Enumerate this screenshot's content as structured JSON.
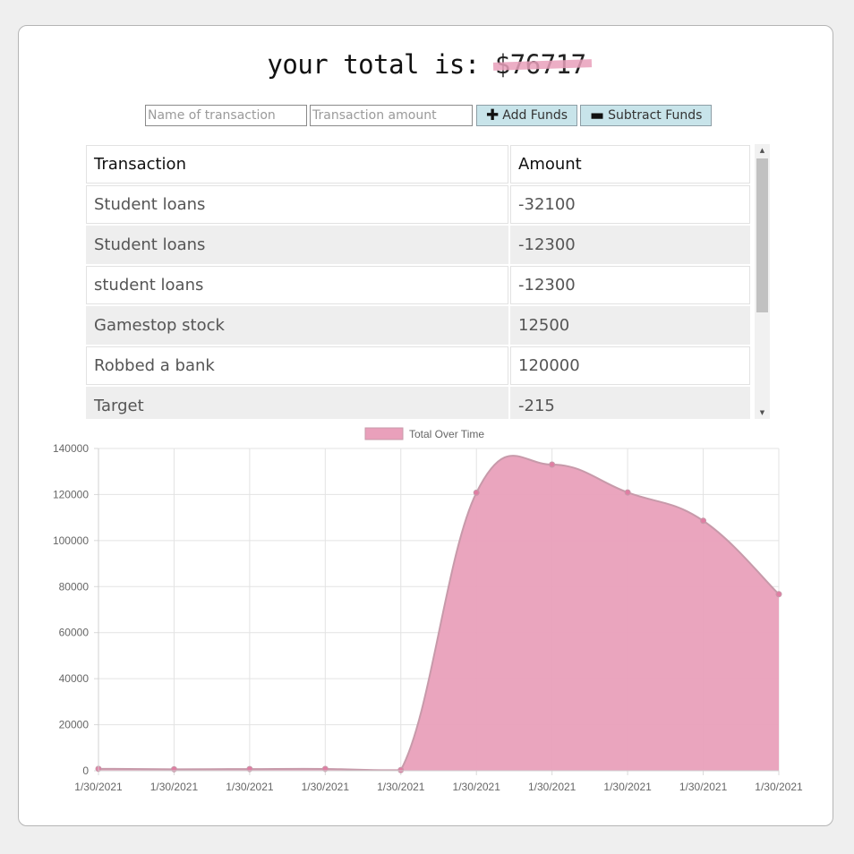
{
  "header": {
    "prefix": "your total is: ",
    "total": "$76717"
  },
  "form": {
    "name_placeholder": "Name of transaction",
    "amount_placeholder": "Transaction amount",
    "add_label": "Add Funds",
    "subtract_label": "Subtract Funds"
  },
  "table": {
    "headers": [
      "Transaction",
      "Amount"
    ],
    "rows": [
      {
        "name": "Student loans",
        "amount": "-32100"
      },
      {
        "name": "Student loans",
        "amount": "-12300"
      },
      {
        "name": "student loans",
        "amount": "-12300"
      },
      {
        "name": "Gamestop stock",
        "amount": "12500"
      },
      {
        "name": "Robbed a bank",
        "amount": "120000"
      },
      {
        "name": "Target",
        "amount": "-215"
      }
    ]
  },
  "chart_data": {
    "type": "area",
    "title": "",
    "legend": "top",
    "grid": true,
    "x": [
      "1/30/2021",
      "1/30/2021",
      "1/30/2021",
      "1/30/2021",
      "1/30/2021",
      "1/30/2021",
      "1/30/2021",
      "1/30/2021",
      "1/30/2021",
      "1/30/2021"
    ],
    "series": [
      {
        "name": "Total Over Time",
        "values": [
          850,
          650,
          750,
          800,
          300,
          120800,
          133000,
          120900,
          108600,
          76717
        ]
      }
    ],
    "ylim": [
      0,
      140000
    ],
    "yticks": [
      0,
      20000,
      40000,
      60000,
      80000,
      100000,
      120000,
      140000
    ],
    "fill_color": "#e9a0bb",
    "line_color": "#c79aaa",
    "point_color": "#e07ea3"
  }
}
